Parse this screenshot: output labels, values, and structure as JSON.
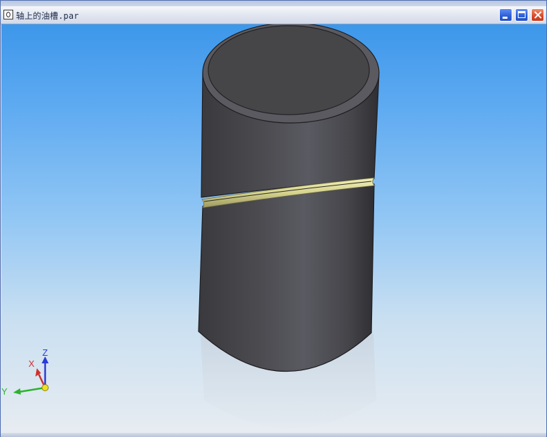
{
  "window": {
    "title": "轴上的油槽.par",
    "icon": "document-icon",
    "controls": [
      "minimize",
      "maximize",
      "close"
    ]
  },
  "viewport": {
    "background_top": "#3d97ea",
    "background_bottom": "#e7ecf1",
    "model": {
      "shape": "cylindrical-shaft",
      "body_color": "#47474c",
      "groove_color": "#d9d79a"
    },
    "triad": {
      "x_label": "X",
      "y_label": "Y",
      "z_label": "Z",
      "x_color": "#d03030",
      "y_color": "#2db32d",
      "z_color": "#2a3bd8"
    }
  }
}
